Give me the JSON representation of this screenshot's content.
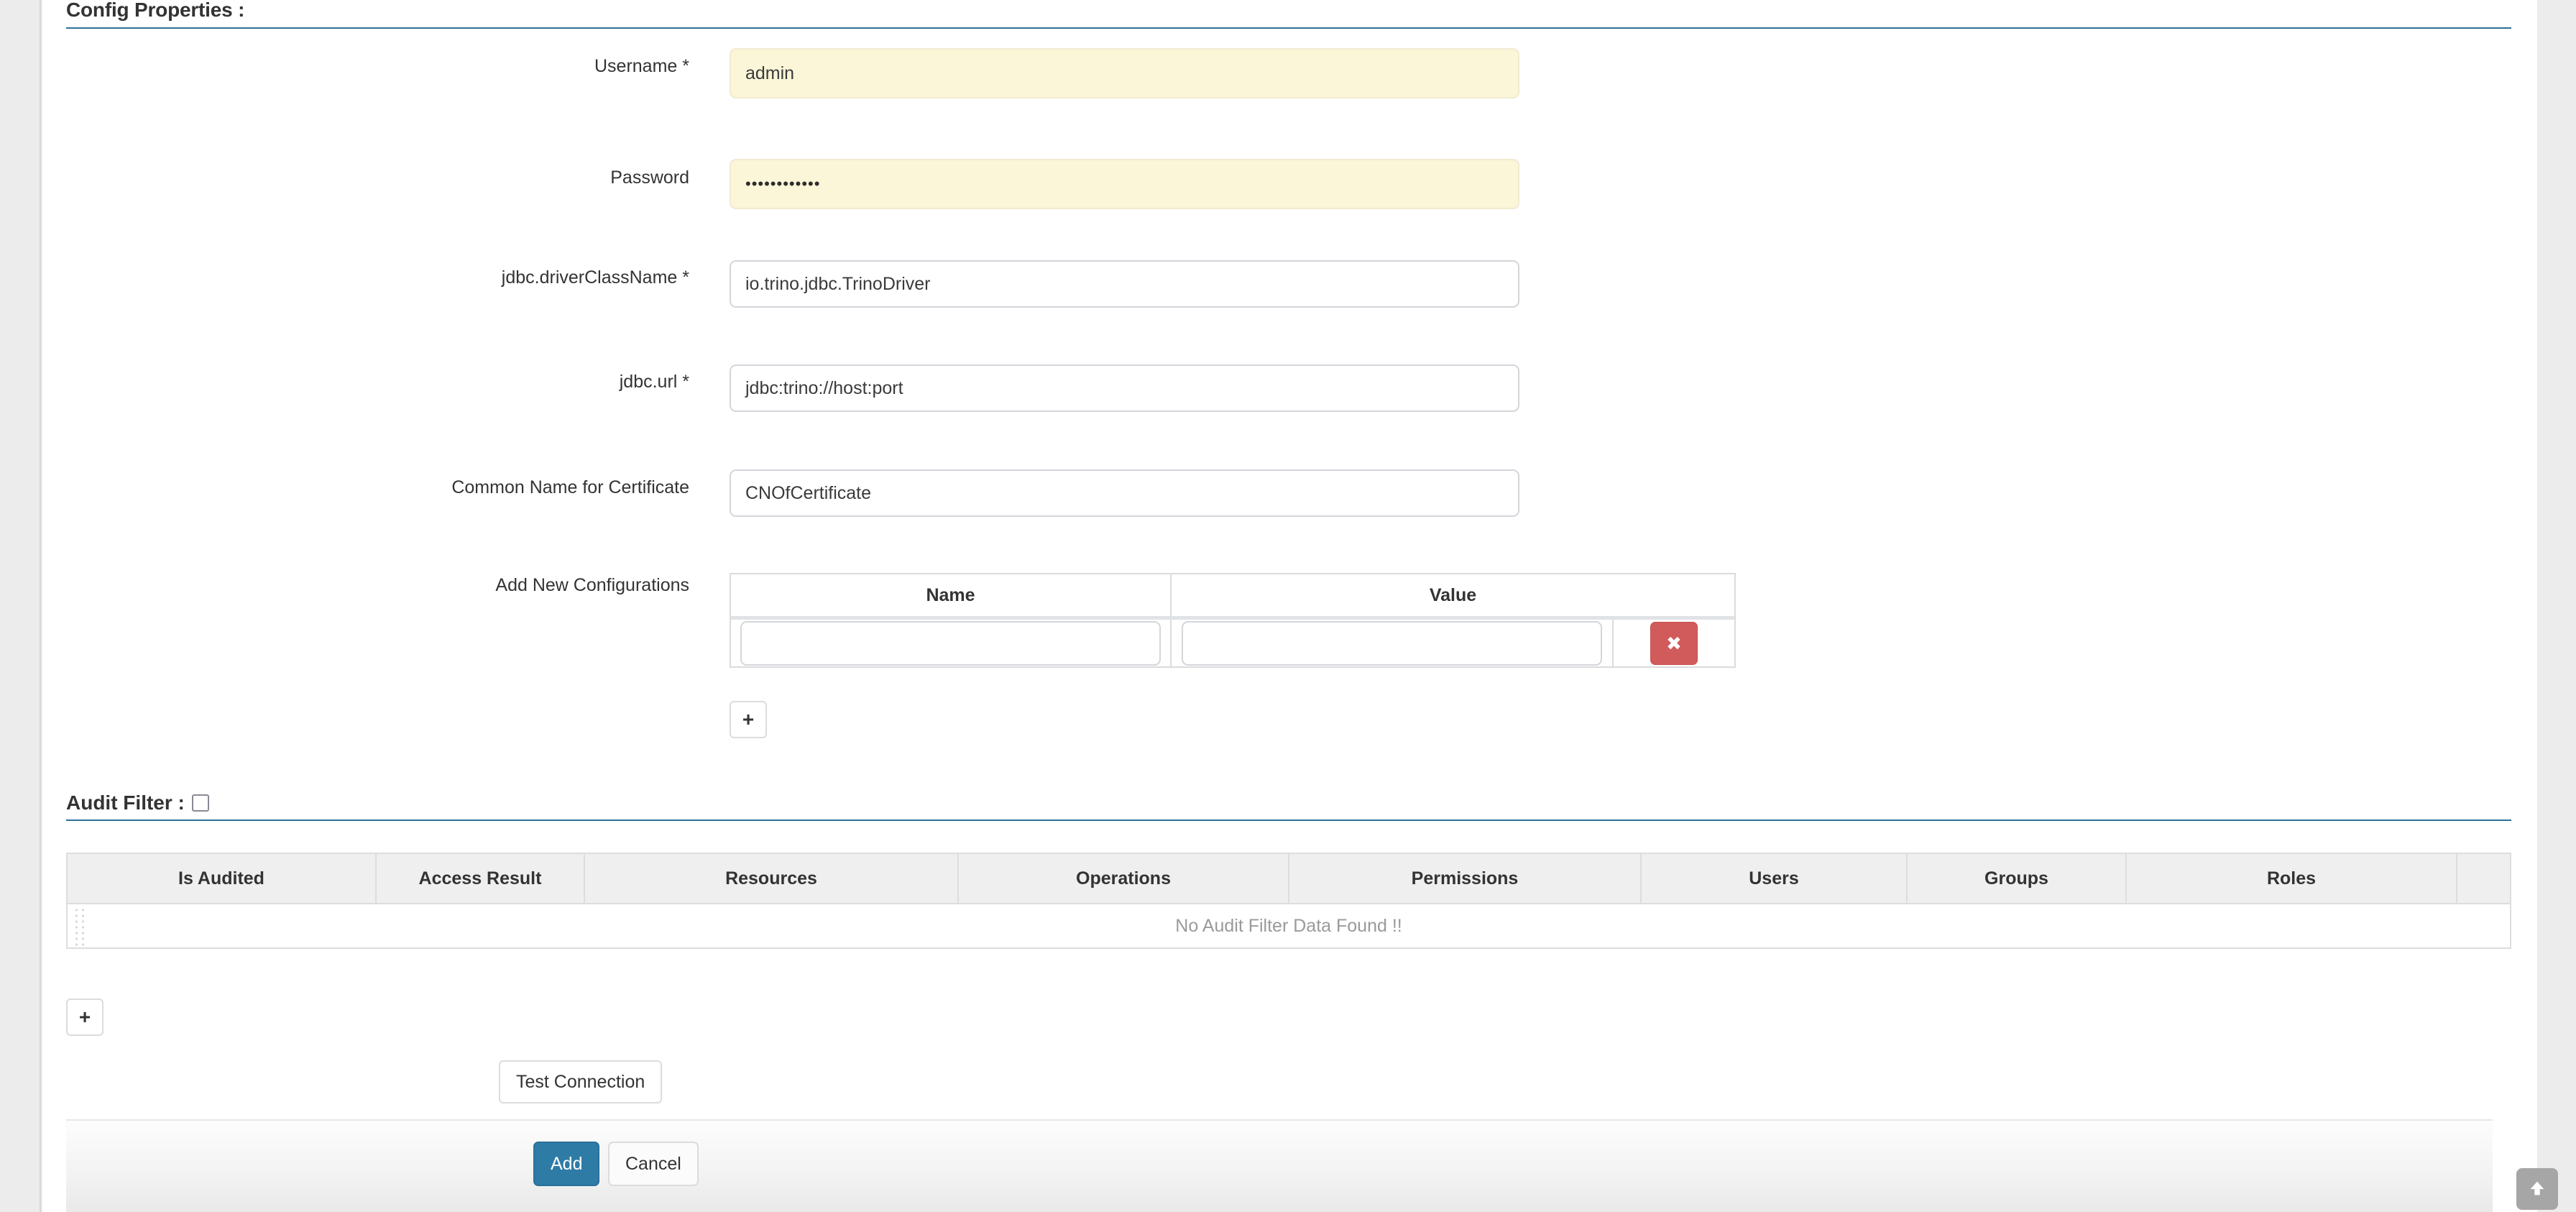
{
  "config_section": {
    "title": "Config Properties :",
    "fields": [
      {
        "label": "Username *",
        "value": "admin",
        "autofill": true,
        "type": "text"
      },
      {
        "label": "Password",
        "value": "••••••••••••",
        "autofill": true,
        "type": "password"
      },
      {
        "label": "jdbc.driverClassName *",
        "value": "io.trino.jdbc.TrinoDriver",
        "autofill": false,
        "type": "text"
      },
      {
        "label": "jdbc.url *",
        "value": "jdbc:trino://host:port",
        "autofill": false,
        "type": "text"
      },
      {
        "label": "Common Name for Certificate",
        "value": "CNOfCertificate",
        "autofill": false,
        "type": "text"
      }
    ],
    "add_new_configurations": {
      "label": "Add New Configurations",
      "columns": [
        "Name",
        "Value"
      ],
      "rows": [
        {
          "name": "",
          "value": "",
          "name_placeholder": "",
          "value_placeholder": "",
          "delete_icon": "✖"
        }
      ],
      "add_row_label": "+"
    }
  },
  "audit_filter_section": {
    "title": "Audit Filter :",
    "checkbox_checked": false,
    "columns": [
      "Is Audited",
      "Access Result",
      "Resources",
      "Operations",
      "Permissions",
      "Users",
      "Groups",
      "Roles"
    ],
    "empty_message": "No Audit Filter Data Found !!",
    "add_row_label": "+"
  },
  "actions": {
    "test_connection_label": "Test Connection",
    "add_label": "Add",
    "cancel_label": "Cancel"
  },
  "scroll_top": {
    "icon": "arrow-up-icon"
  },
  "colors": {
    "accent": "#2a7099",
    "primary_button": "#2e7ba6",
    "danger_button": "#d15b5b",
    "autofill_background": "#fcf6d8",
    "table_header_background": "#efefef",
    "muted_text": "#9a9a9a"
  }
}
